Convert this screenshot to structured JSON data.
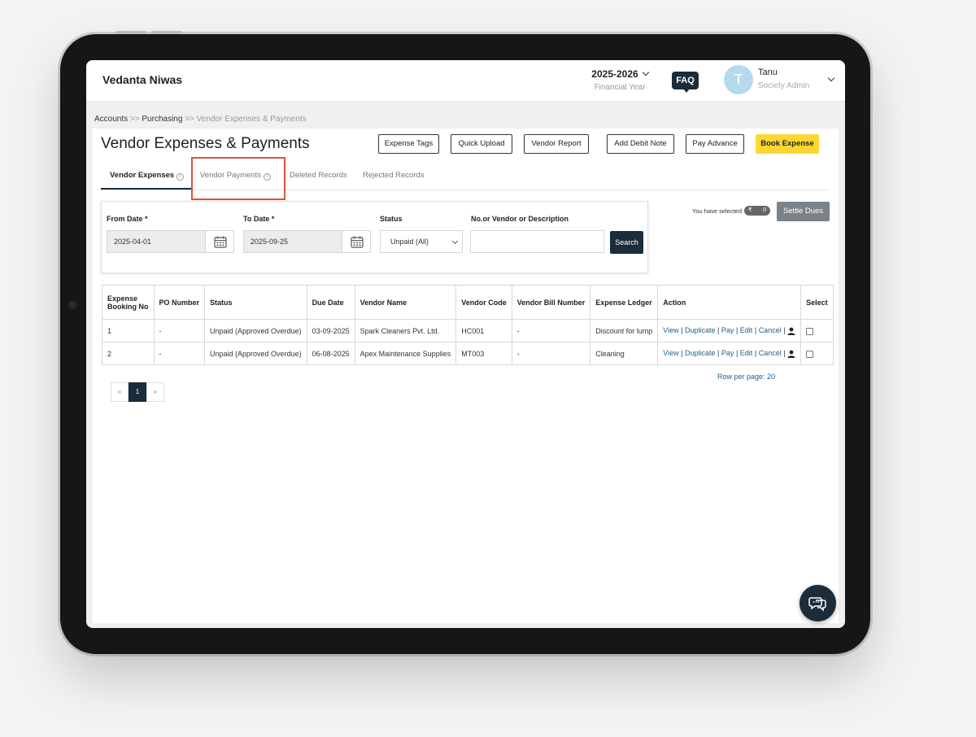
{
  "header": {
    "society_name": "Vedanta Niwas",
    "financial_year": "2025-2026",
    "financial_year_label": "Financial Year",
    "faq_label": "FAQ",
    "user_initial": "T",
    "user_name": "Tanu",
    "user_role": "Society Admin"
  },
  "breadcrumb": {
    "items": [
      "Accounts",
      "Purchasing",
      "Vendor Expenses & Payments"
    ],
    "separator": ">>"
  },
  "page": {
    "title": "Vendor Expenses & Payments"
  },
  "toolbar": {
    "buttons": [
      "Expense Tags",
      "Quick Upload",
      "Vendor Report",
      "Add Debit Note",
      "Pay Advance",
      "Book Expense"
    ]
  },
  "tabs": [
    {
      "label": "Vendor Expenses",
      "active": true
    },
    {
      "label": "Vendor Payments",
      "active": false
    },
    {
      "label": "Deleted Records",
      "active": false
    },
    {
      "label": "Rejected Records",
      "active": false
    }
  ],
  "filters": {
    "from_date_label": "From Date *",
    "from_date_value": "2025-04-01",
    "to_date_label": "To Date *",
    "to_date_value": "2025-09-25",
    "status_label": "Status",
    "status_value": "Unpaid (All)",
    "search_label": "No.or Vendor or Description",
    "search_value": "",
    "search_button": "Search"
  },
  "selection": {
    "text": "You have selected",
    "currency_symbol": "₹",
    "count": "0",
    "settle_button": "Settle Dues"
  },
  "table": {
    "headers": {
      "booking_no_1": "Expense",
      "booking_no_2": "Booking No",
      "po_number": "PO Number",
      "status": "Status",
      "due_date": "Due Date",
      "vendor_name": "Vendor Name",
      "vendor_code": "Vendor Code",
      "vendor_bill_number": "Vendor Bill Number",
      "expense_ledger": "Expense Ledger",
      "action": "Action",
      "select": "Select"
    },
    "actions": [
      "View",
      "Duplicate",
      "Pay",
      "Edit",
      "Cancel"
    ],
    "rows": [
      {
        "booking_no": "1",
        "po_number": "-",
        "status": "Unpaid (Approved Overdue)",
        "due_date": "03-09-2025",
        "vendor_name": "Spark Cleaners Pvt. Ltd.",
        "vendor_code": "HC001",
        "vendor_bill_number": "-",
        "expense_ledger": "Discount for lump"
      },
      {
        "booking_no": "2",
        "po_number": "-",
        "status": "Unpaid (Approved Overdue)",
        "due_date": "06-08-2025",
        "vendor_name": "Apex Maintenance Supplies",
        "vendor_code": "MT003",
        "vendor_bill_number": "-",
        "expense_ledger": "Cleaning"
      }
    ]
  },
  "pagination": {
    "prev": "«",
    "current": "1",
    "next": "»",
    "rows_per_page": "Row per page: 20"
  },
  "colors": {
    "primary": "#1b2c3a",
    "accent_yellow": "#ffd633",
    "highlight_red": "#d9523f",
    "link_blue": "#1f5e8a"
  },
  "icons": [
    "chevron-down-icon",
    "calendar-icon",
    "info-icon",
    "user-icon",
    "chat-icon"
  ]
}
